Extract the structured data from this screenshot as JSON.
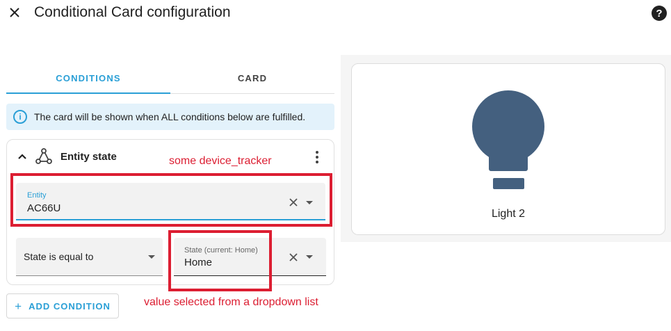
{
  "dialog": {
    "title": "Conditional Card configuration",
    "close_icon": "close-icon",
    "help_icon": "help-icon",
    "help_glyph": "?"
  },
  "tabs": [
    {
      "label": "CONDITIONS",
      "active": true
    },
    {
      "label": "CARD",
      "active": false
    }
  ],
  "info": {
    "icon": "info-icon",
    "glyph": "i",
    "text": "The card will be shown when ALL conditions below are fulfilled."
  },
  "condition": {
    "title": "Entity state",
    "type_icon": "entity-state-icon",
    "entity": {
      "label": "Entity",
      "value": "AC66U"
    },
    "operator": {
      "value": "State is equal to"
    },
    "state": {
      "label": "State (current: Home)",
      "value": "Home"
    }
  },
  "add_button": {
    "icon_glyph": "+",
    "label": "ADD CONDITION"
  },
  "preview": {
    "card_name": "Light 2",
    "icon": "lightbulb-icon",
    "icon_color": "#44607f"
  },
  "annotations": {
    "entity_note": "some device_tracker",
    "state_note": "value selected from a dropdown list",
    "color": "#dc1e32"
  },
  "colors": {
    "accent": "#2a9fd6",
    "info_bg": "#e3f2fb"
  }
}
